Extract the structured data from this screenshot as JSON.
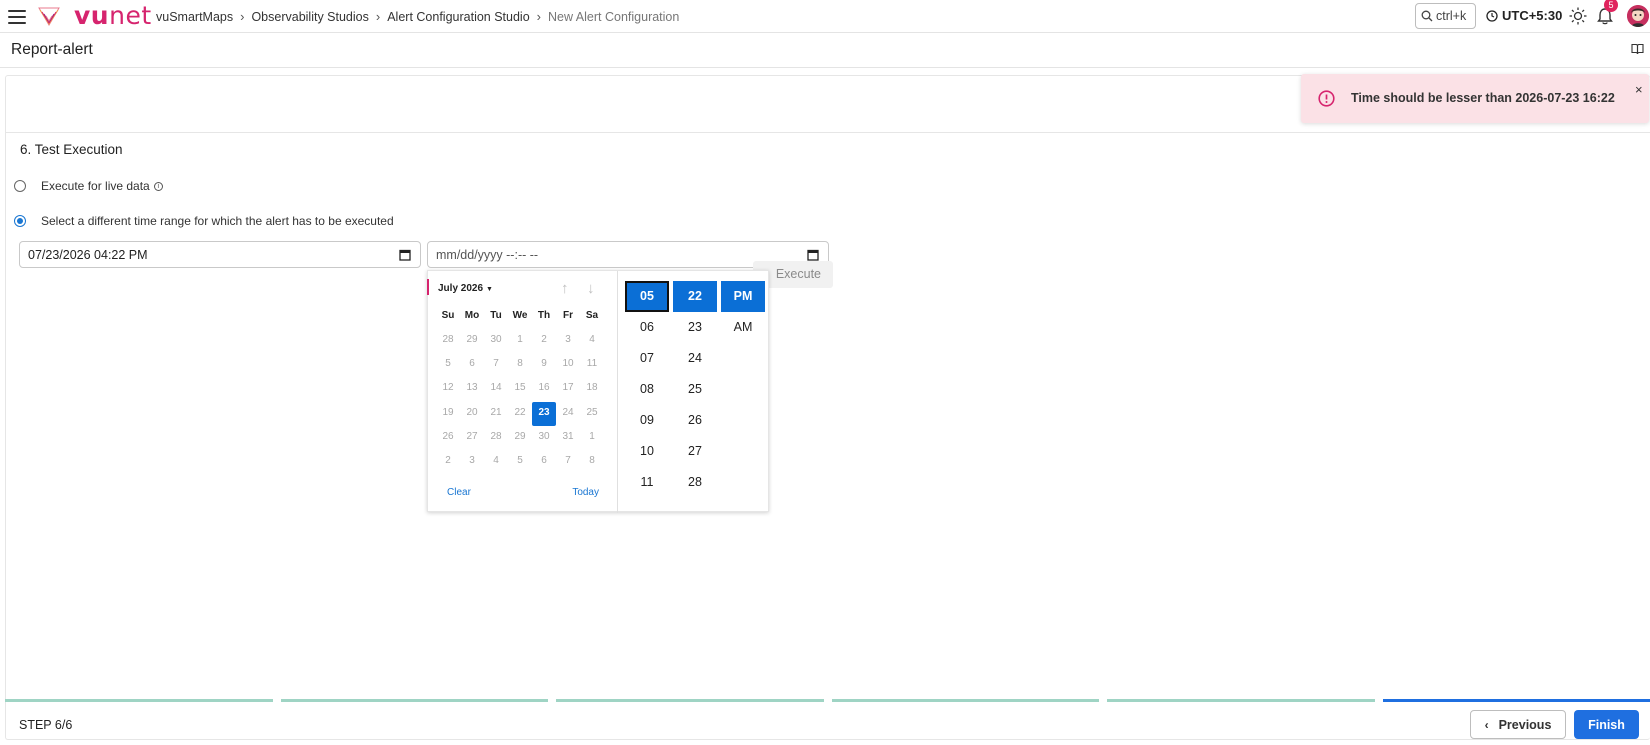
{
  "header": {
    "logo_text_bold": "vu",
    "logo_text_thin": "net",
    "breadcrumbs": [
      "vuSmartMaps",
      "Observability Studios",
      "Alert Configuration Studio",
      "New Alert Configuration"
    ],
    "search_shortcut": "ctrl+k",
    "timezone": "UTC+5:30",
    "notification_count": "5"
  },
  "page": {
    "title": "Report-alert"
  },
  "test_execution": {
    "section_title": "6. Test Execution",
    "option_live": "Execute for live data",
    "option_range": "Select a different time range for which the alert has to be executed",
    "selected_option": "range",
    "start_datetime": "07/23/2026 04:22 PM",
    "end_placeholder": "mm/dd/yyyy --:-- --",
    "execute_label": "Execute"
  },
  "date_picker": {
    "month_label": "July 2026",
    "weekdays": [
      "Su",
      "Mo",
      "Tu",
      "We",
      "Th",
      "Fr",
      "Sa"
    ],
    "weeks": [
      [
        "28",
        "29",
        "30",
        "1",
        "2",
        "3",
        "4"
      ],
      [
        "5",
        "6",
        "7",
        "8",
        "9",
        "10",
        "11"
      ],
      [
        "12",
        "13",
        "14",
        "15",
        "16",
        "17",
        "18"
      ],
      [
        "19",
        "20",
        "21",
        "22",
        "23",
        "24",
        "25"
      ],
      [
        "26",
        "27",
        "28",
        "29",
        "30",
        "31",
        "1"
      ],
      [
        "2",
        "3",
        "4",
        "5",
        "6",
        "7",
        "8"
      ]
    ],
    "selected_day": "23",
    "clear_label": "Clear",
    "today_label": "Today",
    "hours": [
      "05",
      "06",
      "07",
      "08",
      "09",
      "10",
      "11"
    ],
    "minutes": [
      "22",
      "23",
      "24",
      "25",
      "26",
      "27",
      "28"
    ],
    "meridiem": [
      "PM",
      "AM"
    ],
    "selected_hour": "05",
    "selected_minute": "22",
    "selected_meridiem": "PM"
  },
  "toast": {
    "message": "Time should be lesser than 2026-07-23 16:22",
    "close_symbol": "×"
  },
  "footer": {
    "step_label": "STEP 6/6",
    "previous_label": "Previous",
    "finish_label": "Finish",
    "steps_total": 6,
    "current_step": 6
  },
  "colors": {
    "brand": "#d6246e",
    "accent": "#1f6fe0",
    "step_done": "#9fd4c4",
    "step_current": "#1f6fe0",
    "toast_bg": "#fbe1e6"
  }
}
